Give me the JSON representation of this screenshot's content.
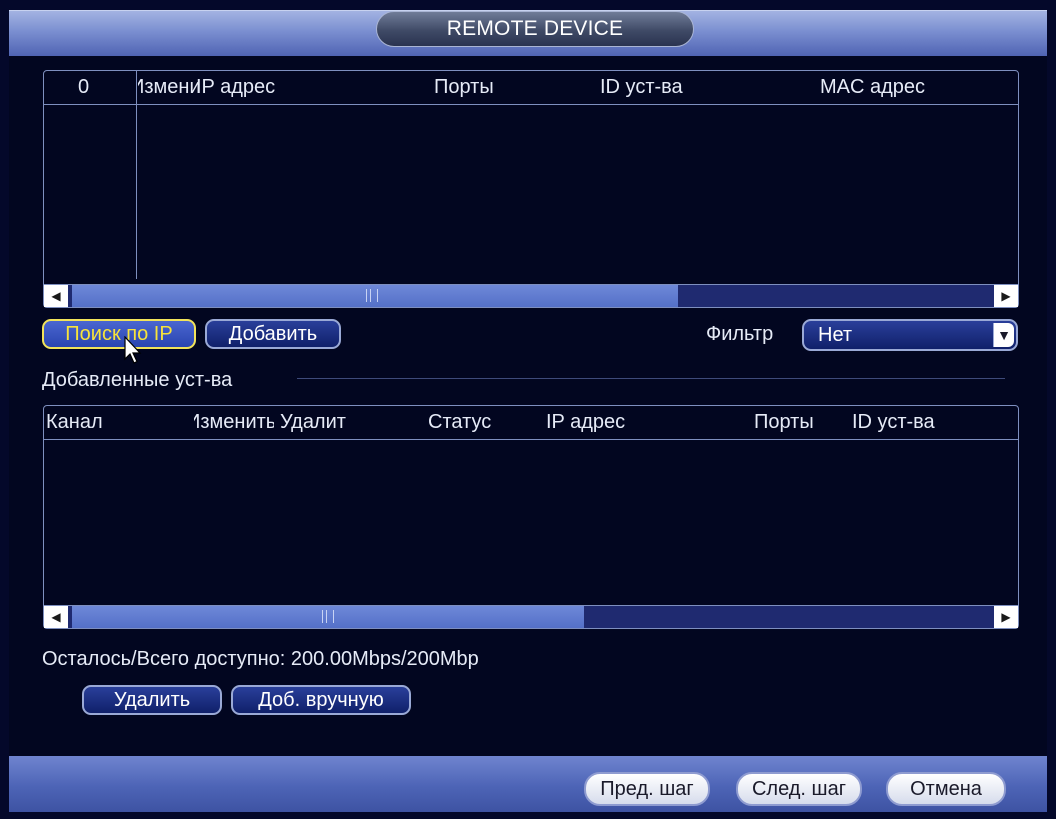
{
  "window": {
    "title": "REMOTE DEVICE"
  },
  "search_table": {
    "columns": [
      "0",
      "Изменить",
      "IP адрес",
      "Порты",
      "ID уст-ва",
      "MAC адрес"
    ],
    "rows": []
  },
  "actions": {
    "search_ip": "Поиск по IP",
    "add": "Добавить"
  },
  "filter": {
    "label": "Фильтр",
    "value": "Нет"
  },
  "added_section": {
    "title": "Добавленные уст-ва"
  },
  "added_table": {
    "columns": [
      "Канал",
      "Изменить",
      "Удалит",
      "Статус",
      "IP адрес",
      "Порты",
      "ID уст-ва"
    ],
    "rows": []
  },
  "bandwidth": {
    "text": "Осталось/Всего доступно: 200.00Mbps/200Mbp"
  },
  "bottom_actions": {
    "delete": "Удалить",
    "add_manual": "Доб. вручную"
  },
  "footer": {
    "prev": "Пред. шаг",
    "next": "След. шаг",
    "cancel": "Отмена"
  },
  "icons": {
    "scroll_left": "scroll-left-arrow-icon",
    "scroll_right": "scroll-right-arrow-icon",
    "dropdown": "chevron-down-icon",
    "cursor": "mouse-cursor-icon"
  },
  "colors": {
    "active_text": "#f7e33a",
    "background": "#020620",
    "header_bar": "#7a8ed0"
  }
}
